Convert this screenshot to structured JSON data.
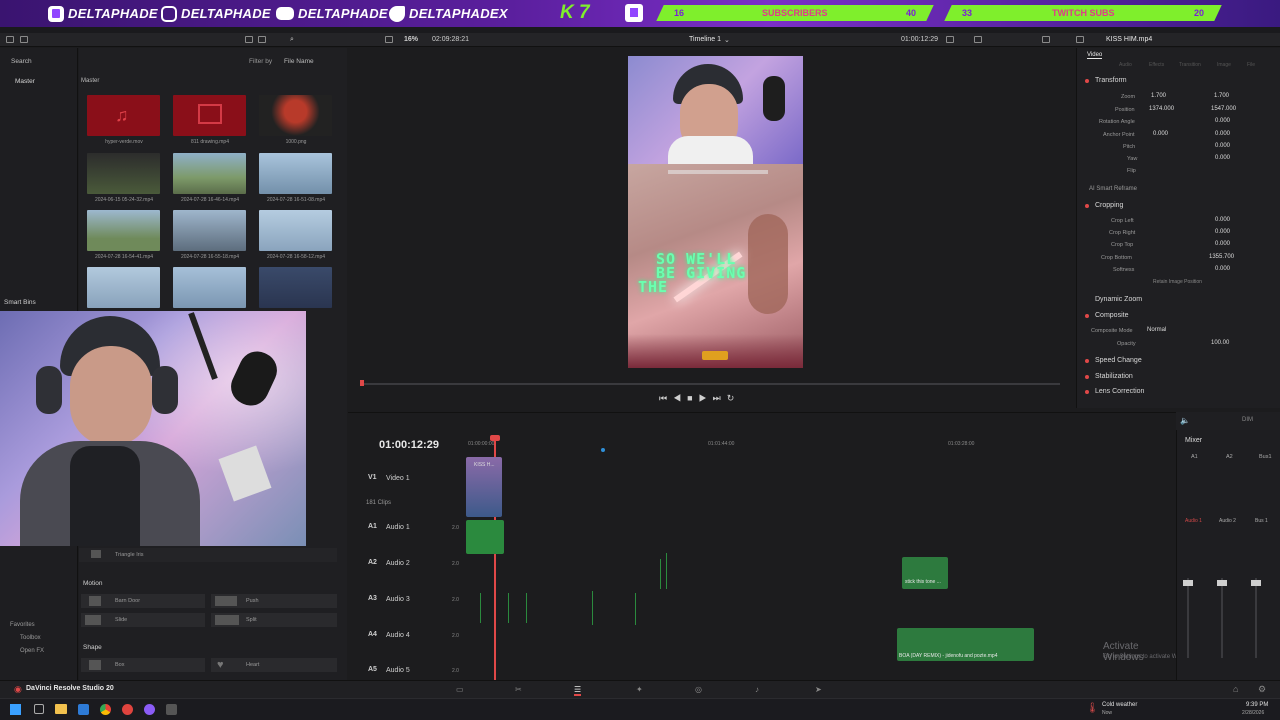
{
  "banner": {
    "handles": [
      {
        "platform": "twitch",
        "name": "DELTAPHADE",
        "color": "#9146ff"
      },
      {
        "platform": "instagram",
        "name": "DELTAPHADE",
        "color": "#ffffff"
      },
      {
        "platform": "youtube",
        "name": "DELTAPHADE",
        "color": "#ffffff"
      },
      {
        "platform": "twitter",
        "name": "DELTAPHADEX",
        "color": "#ffffff"
      }
    ],
    "logo_text": "K 7",
    "goals": [
      {
        "left": "16",
        "label": "SUBSCRIBERS",
        "right": "40"
      },
      {
        "left": "33",
        "label": "TWITCH SUBS",
        "right": "20"
      }
    ]
  },
  "toolbar": {
    "zoom": "16%",
    "source_timecode": "02:09:28:21",
    "timeline_name": "Timeline 1",
    "record_timecode": "01:00:12:29",
    "clip_name": "KISS HIM.mp4"
  },
  "media_pool": {
    "search_label": "Search",
    "filter_label": "Filter by",
    "filter_value": "File Name",
    "master_left": "Master",
    "master_right": "Master",
    "smart_bins": "Smart Bins",
    "items": [
      {
        "label": "hyper-verde.mov"
      },
      {
        "label": "811 drawing.mp4"
      },
      {
        "label": "1000.png"
      },
      {
        "label": "2024-06-15 05-24-32.mp4"
      },
      {
        "label": "2024-07-28 16-46-14.mp4"
      },
      {
        "label": "2024-07-28 16-51-08.mp4"
      },
      {
        "label": "2024-07-28 16-54-41.mp4"
      },
      {
        "label": "2024-07-28 16-55-18.mp4"
      },
      {
        "label": "2024-07-28 16-58-12.mp4"
      }
    ]
  },
  "effects": {
    "triangle": "Triangle Iris",
    "motion_header": "Motion",
    "motion_items": [
      "Barn Door",
      "Push",
      "Slide",
      "Split"
    ],
    "shape_header": "Shape",
    "shape_items": [
      "Box",
      "Heart"
    ],
    "side_items": [
      "Favorites",
      "Toolbox",
      "Open FX"
    ]
  },
  "viewer": {
    "caption_line1": "SO WE'LL",
    "caption_line2": "BE GIVING",
    "caption_line3": "THE"
  },
  "inspector": {
    "tabs": [
      "Video",
      "Audio",
      "Effects",
      "Transition",
      "Image",
      "File"
    ],
    "transform": "Transform",
    "zoom_label": "Zoom",
    "zoom_x": "1.700",
    "zoom_y": "1.700",
    "position_label": "Position",
    "position_x": "1374.000",
    "position_y": "1547.000",
    "rotation_label": "Rotation Angle",
    "rotation": "0.000",
    "anchor_label": "Anchor Point",
    "anchor_x": "0.000",
    "anchor_y": "0.000",
    "pitch_label": "Pitch",
    "pitch": "0.000",
    "yaw_label": "Yaw",
    "yaw": "0.000",
    "flip_label": "Flip",
    "smart_reframe": "AI Smart Reframe",
    "cropping": "Cropping",
    "crop_left_label": "Crop Left",
    "crop_left": "0.000",
    "crop_right_label": "Crop Right",
    "crop_right": "0.000",
    "crop_top_label": "Crop Top",
    "crop_top": "0.000",
    "crop_bottom_label": "Crop Bottom",
    "crop_bottom": "1355.700",
    "softness_label": "Softness",
    "softness": "0.000",
    "retain": "Retain Image Position",
    "dynamic_zoom": "Dynamic Zoom",
    "composite": "Composite",
    "composite_mode_label": "Composite Mode",
    "composite_mode": "Normal",
    "opacity_label": "Opacity",
    "opacity": "100.00",
    "speed_change": "Speed Change",
    "stabilization": "Stabilization",
    "lens_correction": "Lens Correction"
  },
  "timeline": {
    "timecode": "01:00:12:29",
    "ruler": [
      "01:00:00:00",
      "01:01:44:00",
      "01:03:28:00"
    ],
    "tracks": [
      {
        "id": "V1",
        "name": "Video 1",
        "sub": "181 Clips"
      },
      {
        "id": "A1",
        "name": "Audio 1",
        "level": "2.0"
      },
      {
        "id": "A2",
        "name": "Audio 2",
        "level": "2.0"
      },
      {
        "id": "A3",
        "name": "Audio 3",
        "level": "2.0"
      },
      {
        "id": "A4",
        "name": "Audio 4",
        "level": "2.0"
      },
      {
        "id": "A5",
        "name": "Audio 5",
        "level": "2.0"
      }
    ],
    "clip_v1": "KISS H...",
    "clip_a2": "stick this tone ...",
    "clip_a4": "BOA (DAY REMIX) - jidenofu and pozte.mp4",
    "activate_title": "Activate Windows",
    "activate_sub": "Go to Settings to activate Windows."
  },
  "mixer": {
    "title": "Mixer",
    "dim": "DIM",
    "channels": [
      "A1",
      "A2",
      "Bus1"
    ],
    "channel_labels": [
      "Audio 1",
      "Audio 2",
      "Bus 1"
    ]
  },
  "resolve_bar": {
    "app_name": "DaVinci Resolve Studio 20"
  },
  "taskbar": {
    "weather": "Cold weather",
    "weather_sub": "Now",
    "time": "9:39 PM",
    "date": "2/28/2026"
  }
}
